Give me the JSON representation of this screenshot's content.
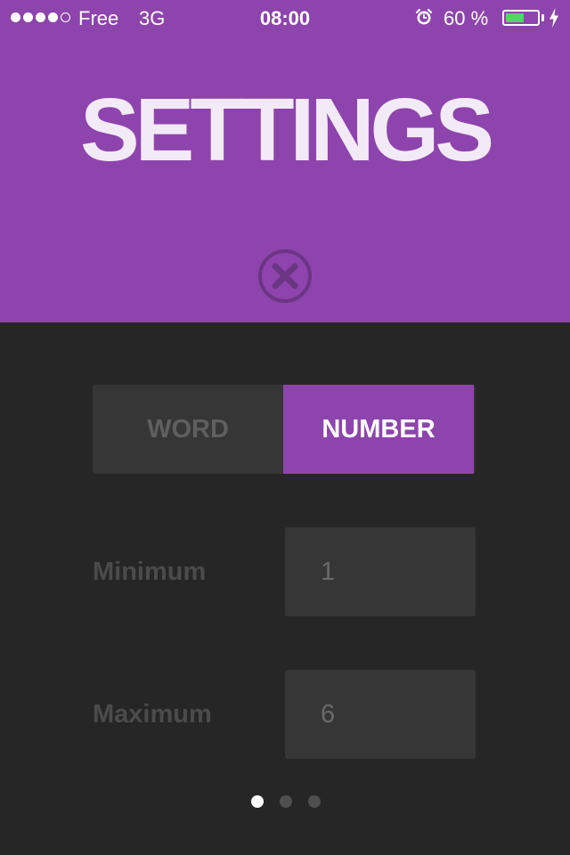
{
  "status_bar": {
    "carrier": "Free",
    "network": "3G",
    "time": "08:00",
    "battery_percent_text": "60 %",
    "battery_level": 0.6,
    "signal_bars_filled": 4,
    "signal_bars_total": 5,
    "icons": [
      "signal-dots-icon",
      "alarm-clock-icon",
      "battery-icon",
      "charging-bolt-icon"
    ]
  },
  "header": {
    "title": "SETTINGS",
    "close_icon": "close-circle-icon",
    "background_color": "#8e44ad"
  },
  "mode_toggle": {
    "options": [
      "WORD",
      "NUMBER"
    ],
    "selected": "NUMBER",
    "accent_color": "#8e44ad"
  },
  "fields": {
    "minimum": {
      "label": "Minimum",
      "value": "1"
    },
    "maximum": {
      "label": "Maximum",
      "value": "6"
    }
  },
  "pagination": {
    "total_pages": 3,
    "current_page": 1
  },
  "colors": {
    "background": "#262626",
    "control": "#363636",
    "battery_fill": "#4cd964"
  }
}
